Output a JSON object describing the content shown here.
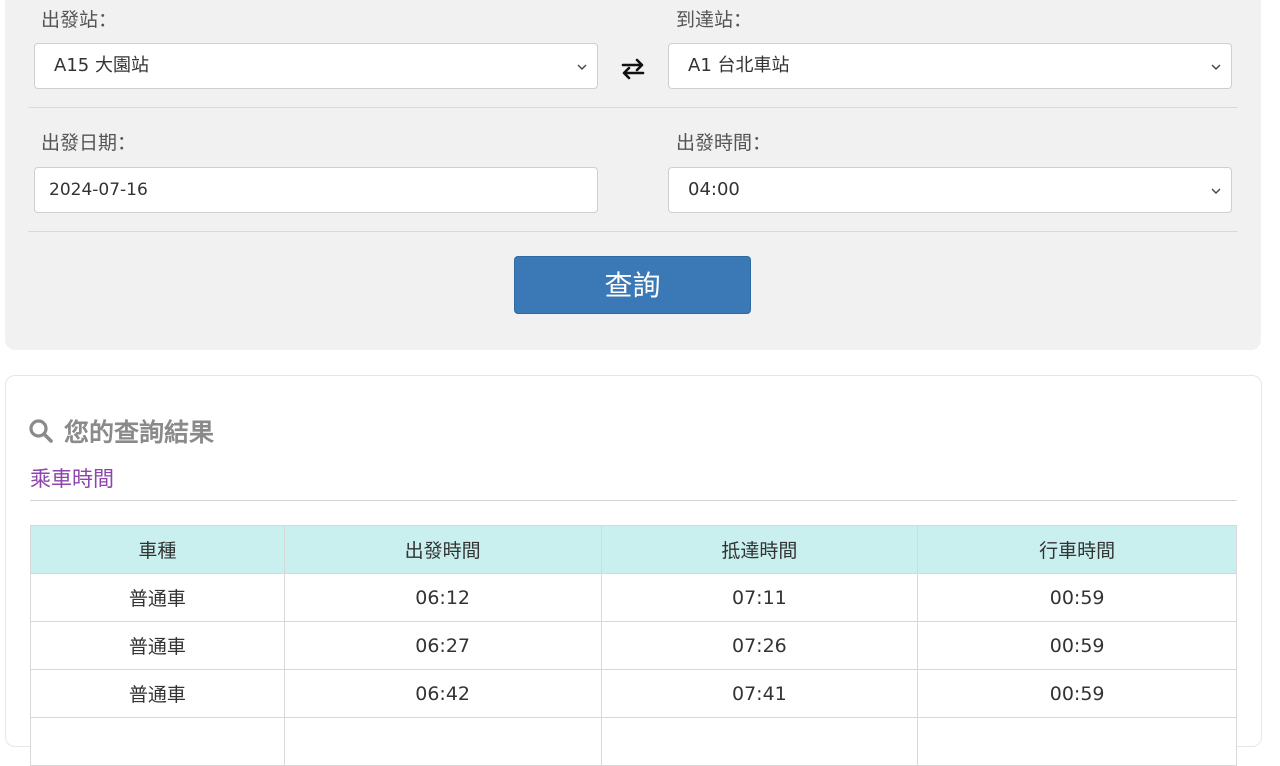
{
  "form": {
    "departure_label": "出發站：",
    "departure_value": "A15 大園站",
    "arrival_label": "到達站：",
    "arrival_value": "A1 台北車站",
    "date_label": "出發日期：",
    "date_value": "2024-07-16",
    "time_label": "出發時間：",
    "time_value": "04:00",
    "submit_label": "查詢"
  },
  "results": {
    "title": "您的查詢結果",
    "subtitle": "乘車時間",
    "headers": [
      "車種",
      "出發時間",
      "抵達時間",
      "行車時間"
    ],
    "rows": [
      [
        "普通車",
        "06:12",
        "07:11",
        "00:59"
      ],
      [
        "普通車",
        "06:27",
        "07:26",
        "00:59"
      ],
      [
        "普通車",
        "06:42",
        "07:41",
        "00:59"
      ],
      [
        "",
        "",
        "",
        ""
      ]
    ]
  },
  "icons": {
    "swap": "swap-arrows-icon",
    "search": "search-icon",
    "dropdown": "chevron-down-icon"
  },
  "colors": {
    "panel_bg": "#f1f1f1",
    "button": "#3b79b6",
    "subtitle": "#8e44ad",
    "table_header": "#c9f0ef"
  }
}
